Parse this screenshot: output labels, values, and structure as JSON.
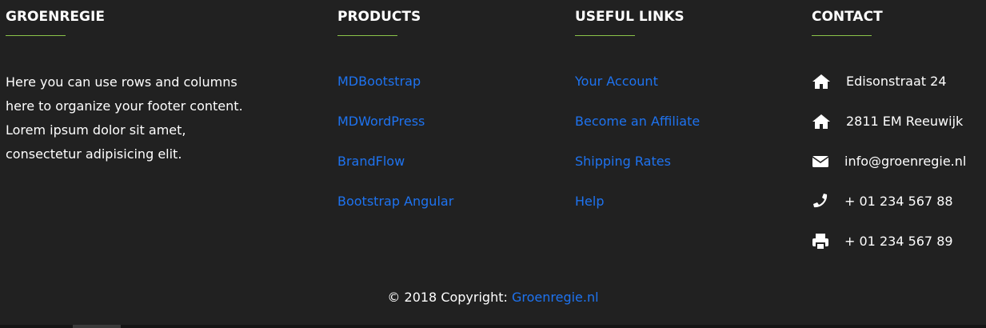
{
  "about": {
    "heading": "GROENREGIE",
    "text": "Here you can use rows and columns here to organize your footer content. Lorem ipsum dolor sit amet, consectetur adipisicing elit."
  },
  "products": {
    "heading": "PRODUCTS",
    "items": [
      {
        "label": "MDBootstrap"
      },
      {
        "label": "MDWordPress"
      },
      {
        "label": "BrandFlow"
      },
      {
        "label": "Bootstrap Angular"
      }
    ]
  },
  "useful_links": {
    "heading": "USEFUL LINKS",
    "items": [
      {
        "label": "Your Account"
      },
      {
        "label": "Become an Affiliate"
      },
      {
        "label": "Shipping Rates"
      },
      {
        "label": "Help"
      }
    ]
  },
  "contact": {
    "heading": "CONTACT",
    "items": [
      {
        "icon": "home-icon",
        "text": "Edisonstraat 24"
      },
      {
        "icon": "home-icon",
        "text": "2811 EM Reeuwijk"
      },
      {
        "icon": "envelope-icon",
        "text": "info@groenregie.nl"
      },
      {
        "icon": "phone-icon",
        "text": "+ 01 234 567 88"
      },
      {
        "icon": "print-icon",
        "text": "+ 01 234 567 89"
      }
    ]
  },
  "copyright": {
    "prefix": "© 2018 Copyright: ",
    "link_label": "Groenregie.nl"
  },
  "colors": {
    "background": "#212121",
    "accent_line": "#8bc34a",
    "link": "#1e73f0",
    "text": "#ffffff"
  }
}
